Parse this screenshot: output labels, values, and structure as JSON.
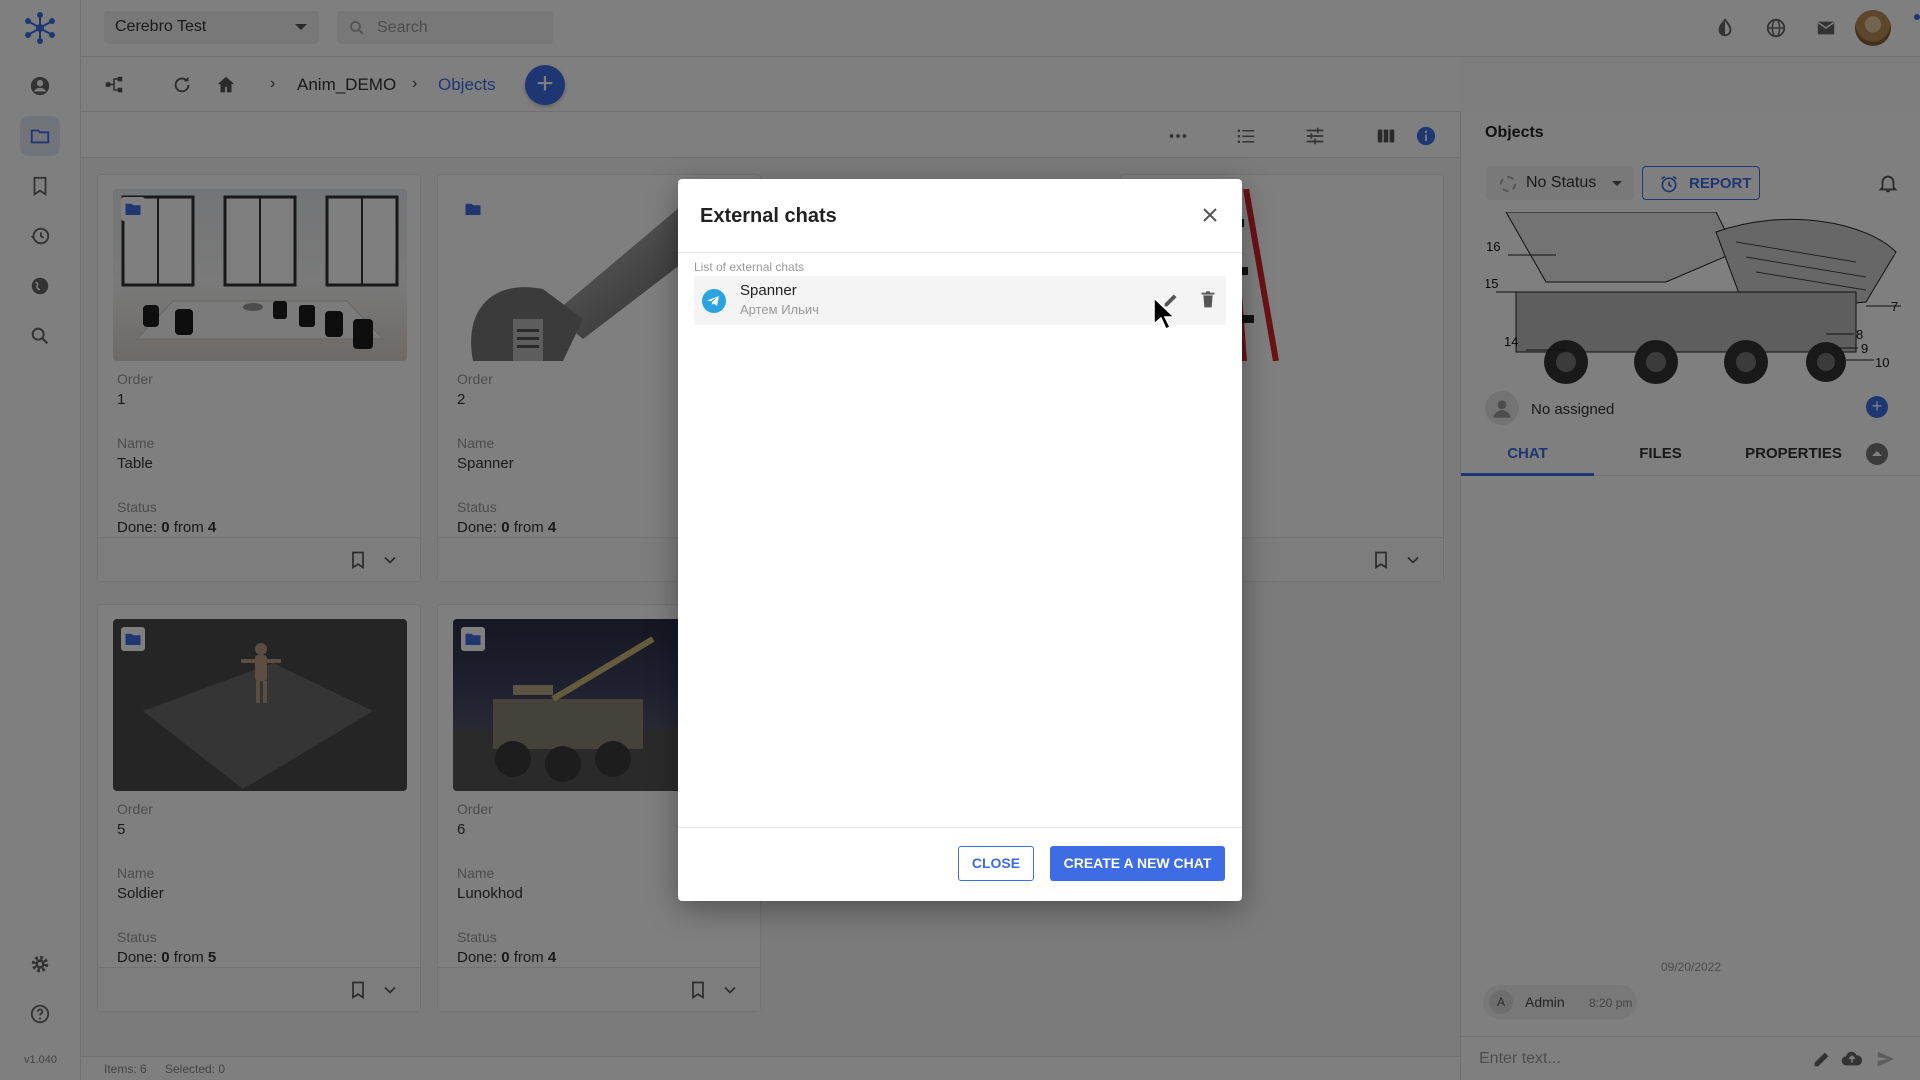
{
  "app": {
    "version": "v1.040",
    "project": "Cerebro Test",
    "search_placeholder": "Search"
  },
  "breadcrumb": {
    "items": [
      "Anim_DEMO",
      "Objects"
    ]
  },
  "cards": [
    {
      "order_label": "Order",
      "order": "1",
      "name_label": "Name",
      "name": "Table",
      "status_label": "Status",
      "done_prefix": "Done:",
      "done": "0",
      "from_word": "from",
      "total": "4"
    },
    {
      "order_label": "Order",
      "order": "2",
      "name_label": "Name",
      "name": "Spanner",
      "status_label": "Status",
      "done_prefix": "Done:",
      "done": "0",
      "from_word": "from",
      "total": "4"
    },
    {
      "order_label": "Order",
      "order": "5",
      "name_label": "Name",
      "name": "Soldier",
      "status_label": "Status",
      "done_prefix": "Done:",
      "done": "0",
      "from_word": "from",
      "total": "5"
    },
    {
      "order_label": "Order",
      "order": "6",
      "name_label": "Name",
      "name": "Lunokhod",
      "status_label": "Status",
      "done_prefix": "Done:",
      "done": "0",
      "from_word": "from",
      "total": "4"
    }
  ],
  "statusbar": {
    "items": "Items: 6",
    "selected": "Selected: 0"
  },
  "right_panel": {
    "title": "Objects",
    "status": "No Status",
    "report_label": "REPORT",
    "assigned": "No assigned",
    "preview_labels": [
      "16",
      "15",
      "14",
      "7",
      "8",
      "9",
      "10"
    ],
    "tabs": [
      "CHAT",
      "FILES",
      "PROPERTIES"
    ],
    "chat_date": "09/20/2022",
    "message": {
      "initial": "A",
      "author": "Admin",
      "time": "8:20 pm"
    },
    "input_placeholder": "Enter text..."
  },
  "modal": {
    "title": "External chats",
    "list_caption": "List of external chats",
    "chats": [
      {
        "name": "Spanner",
        "subtitle": "Артем Ильич"
      }
    ],
    "close_label": "CLOSE",
    "create_label": "CREATE A NEW CHAT"
  },
  "colors": {
    "accent": "#3d6ce5",
    "overlay": "rgba(0,0,0,0.5)",
    "telegram": "#2aa3e0"
  },
  "icons": [
    "logo-icon",
    "user-icon",
    "folder-icon",
    "bookmark-icon",
    "history-icon",
    "globe-icon",
    "search-icon",
    "settings-icon",
    "help-icon",
    "contrast-icon",
    "language-icon",
    "mail-icon",
    "hierarchy-icon",
    "refresh-icon",
    "home-icon",
    "more-icon",
    "list-view-icon",
    "filter-icon",
    "columns-icon",
    "info-icon",
    "bell-icon",
    "alarm-icon",
    "telegram-icon",
    "edit-icon",
    "delete-icon",
    "close-icon",
    "send-icon",
    "upload-icon"
  ]
}
